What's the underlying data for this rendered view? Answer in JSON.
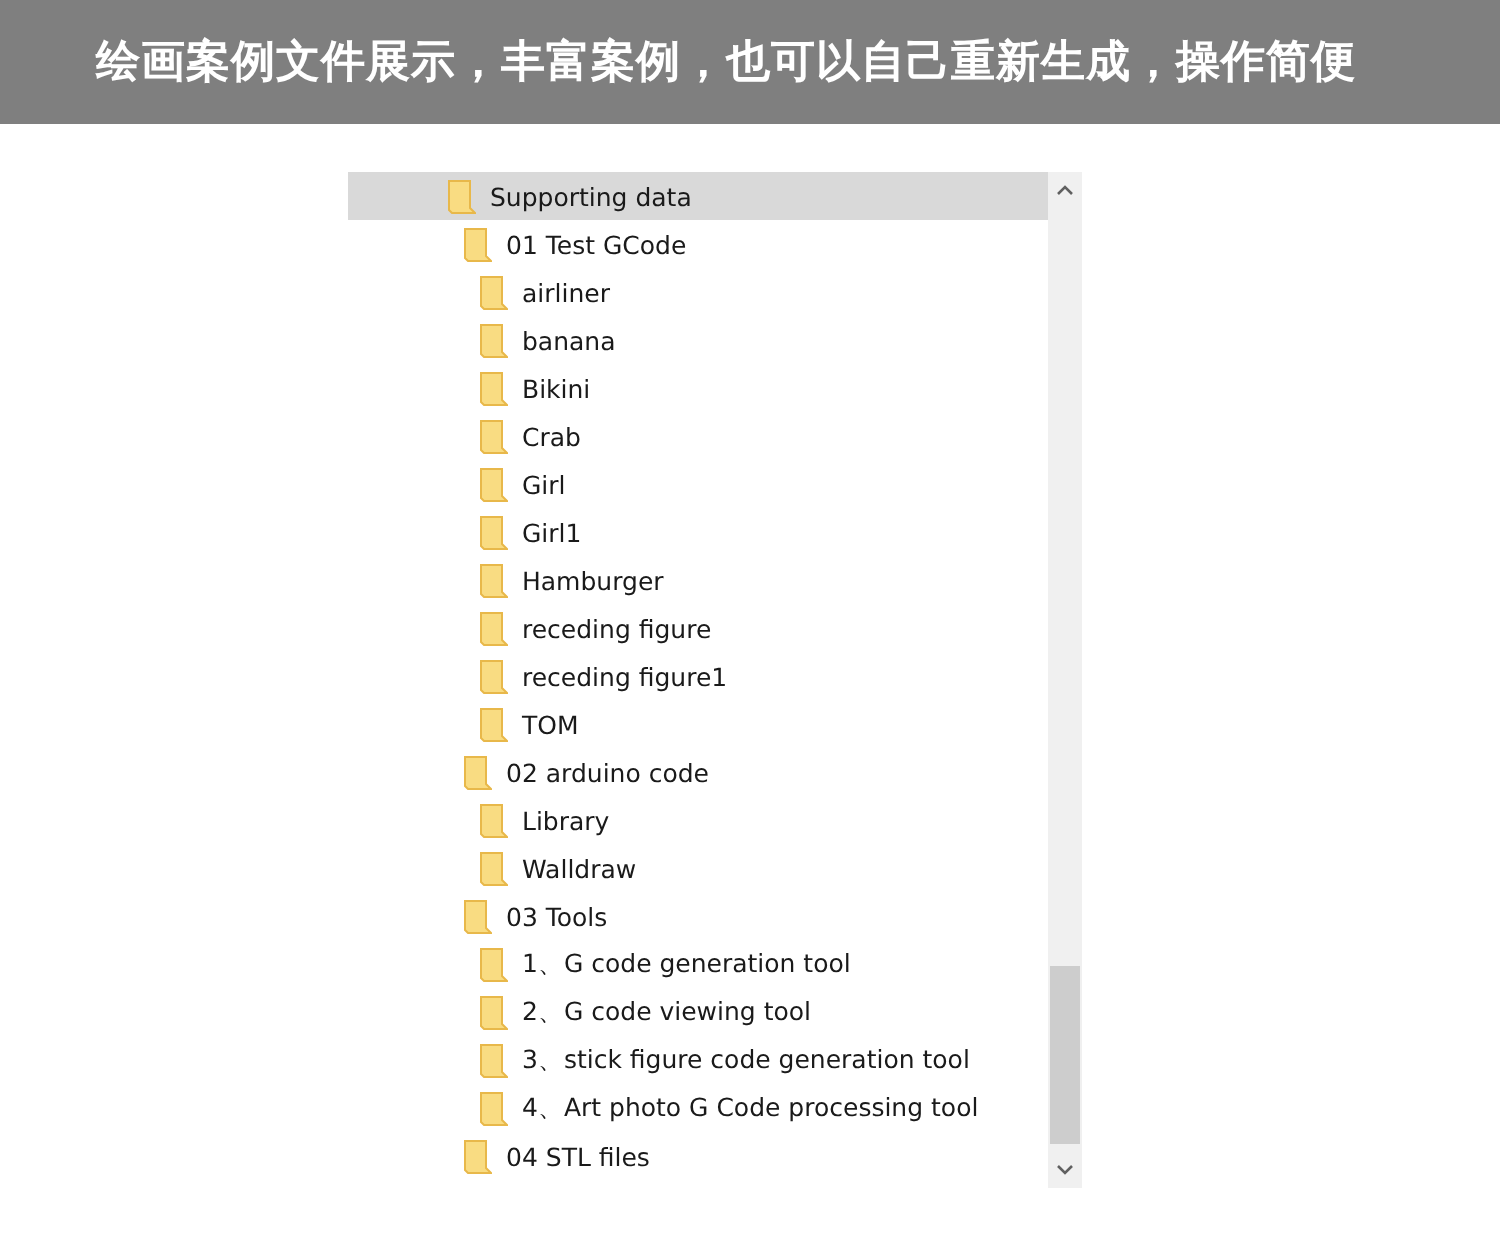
{
  "banner": {
    "title": "绘画案例文件展示，丰富案例，也可以自己重新生成，操作简便"
  },
  "tree": [
    {
      "label": "Supporting data",
      "selected": true,
      "children": [
        {
          "label": "01 Test GCode",
          "selected": false,
          "children": [
            {
              "label": "airliner",
              "selected": false
            },
            {
              "label": "banana",
              "selected": false
            },
            {
              "label": "Bikini",
              "selected": false
            },
            {
              "label": "Crab",
              "selected": false
            },
            {
              "label": "Girl",
              "selected": false
            },
            {
              "label": "Girl1",
              "selected": false
            },
            {
              "label": "Hamburger",
              "selected": false
            },
            {
              "label": "receding figure",
              "selected": false
            },
            {
              "label": "receding figure1",
              "selected": false
            },
            {
              "label": "TOM",
              "selected": false
            }
          ]
        },
        {
          "label": "02 arduino code",
          "selected": false,
          "children": [
            {
              "label": "Library",
              "selected": false
            },
            {
              "label": "Walldraw",
              "selected": false
            }
          ]
        },
        {
          "label": "03 Tools",
          "selected": false,
          "children": [
            {
              "label": "1、G code generation tool",
              "selected": false
            },
            {
              "label": "2、G code viewing tool",
              "selected": false
            },
            {
              "label": "3、stick figure code generation tool",
              "selected": false
            },
            {
              "label": "4、Art photo G Code processing tool",
              "selected": false
            }
          ]
        },
        {
          "label": "04 STL files",
          "selected": false
        }
      ]
    }
  ]
}
